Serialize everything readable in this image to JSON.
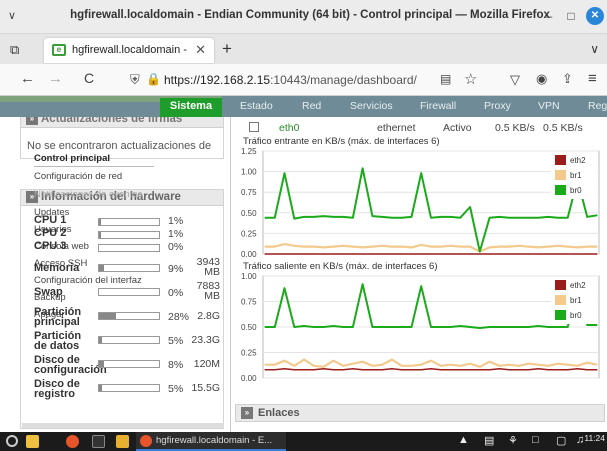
{
  "window": {
    "title": "hgfirewall.localdomain - Endian Community (64 bit) - Control principal — Mozilla Firefox",
    "menu_glyph": "∨",
    "min": "–",
    "max": "□",
    "close": "✕"
  },
  "tab": {
    "title": "hgfirewall.localdomain - Enc",
    "close": "✕",
    "new": "+",
    "list": "⧉",
    "dropdown": "∨"
  },
  "nav": {
    "back": "←",
    "forward": "→",
    "reload": "C",
    "url_host": "https://192.168.2.15",
    "url_path": ":10443/manage/dashboard/",
    "reader": "▤",
    "bookmark": "☆",
    "pocket": "▽",
    "account": "◉",
    "share": "⇪",
    "menu": "≡"
  },
  "appnav": {
    "active": "Sistema",
    "items": [
      "Estado",
      "Red",
      "Servicios",
      "Firewall",
      "Proxy",
      "VPN",
      "Regi"
    ]
  },
  "sidebar": {
    "updates_title": "Actualizaciones de firmas",
    "updates_text": "No se encontraron actualizaciones de",
    "hw_title": "Información del hardware",
    "menu": [
      "Control principal",
      "Configuración de red",
      "Notificaciones de eventos",
      "Updates",
      "Usuarios",
      "Consola web",
      "Acceso SSH",
      "Configuración del interfaz",
      "Backup",
      "Apagar"
    ],
    "hardware": [
      {
        "label": "CPU 1",
        "percent": "1%",
        "fill": 0.01,
        "size": ""
      },
      {
        "label": "CPU 2",
        "percent": "1%",
        "fill": 0.01,
        "size": ""
      },
      {
        "label": "CPU 3",
        "percent": "0%",
        "fill": 0.0,
        "size": ""
      },
      {
        "label": "Memoria",
        "percent": "9%",
        "fill": 0.09,
        "size": "3943 MB"
      },
      {
        "label": "Swap",
        "percent": "0%",
        "fill": 0.0,
        "size": "7883 MB"
      },
      {
        "label": "Partición principal",
        "percent": "28%",
        "fill": 0.28,
        "size": "2.8G"
      },
      {
        "label": "Partición de datos",
        "percent": "5%",
        "fill": 0.05,
        "size": "23.3G"
      },
      {
        "label": "Disco de configuración",
        "percent": "8%",
        "fill": 0.08,
        "size": "120M"
      },
      {
        "label": "Disco de registro",
        "percent": "5%",
        "fill": 0.05,
        "size": "15.5G"
      }
    ]
  },
  "interface_row": {
    "name": "eth0",
    "type": "ethernet",
    "state": "Activo",
    "in": "0.5 KB/s",
    "out": "0.5 KB/s"
  },
  "enlaces": "Enlaces",
  "taskbar": {
    "task_label": "hgfirewall.localdomain - E...",
    "clock": "11:24"
  },
  "chart_data": [
    {
      "type": "line",
      "title": "Tráfico entrante en KB/s (máx. de interfaces 6)",
      "ylim": [
        0,
        1.25
      ],
      "yticks": [
        "1.25",
        "1.00",
        "0.75",
        "0.50",
        "0.25",
        "0.00"
      ],
      "colors": {
        "eth2": "#9b1c1c",
        "br1": "#f4c98c",
        "br0": "#1aaa1a"
      },
      "series": [
        {
          "name": "eth2",
          "values": [
            0,
            0,
            0,
            0,
            0,
            0,
            0,
            0,
            0,
            0,
            0,
            0,
            0,
            0,
            0,
            0,
            0,
            0,
            0,
            0,
            0,
            0,
            0,
            0,
            0,
            0,
            0,
            0,
            0,
            0,
            0,
            0,
            0,
            0,
            0
          ]
        },
        {
          "name": "br1",
          "values": [
            0.09,
            0.09,
            0.12,
            0.1,
            0.09,
            0.09,
            0.08,
            0.09,
            0.1,
            0.09,
            0.08,
            0.09,
            0.1,
            0.09,
            0.09,
            0.08,
            0.11,
            0.09,
            0.09,
            0.1,
            0.09,
            0.09,
            0.03,
            0.08,
            0.09,
            0.09,
            0.1,
            0.09,
            0.08,
            0.09,
            0.1,
            0.09,
            0.08,
            0.09,
            0.09
          ]
        },
        {
          "name": "br0",
          "values": [
            0.44,
            0.44,
            0.98,
            0.43,
            0.45,
            0.45,
            0.46,
            0.45,
            0.45,
            0.44,
            1.04,
            0.46,
            0.45,
            0.44,
            0.44,
            0.45,
            0.98,
            0.44,
            0.45,
            0.45,
            0.44,
            0.57,
            0.03,
            0.44,
            0.45,
            0.44,
            0.44,
            0.44,
            0.44,
            0.45,
            0.44,
            0.44,
            0.9,
            0.45,
            0.47
          ]
        }
      ]
    },
    {
      "type": "line",
      "title": "Tráfico saliente en KB/s (máx. de interfaces 6)",
      "ylim": [
        0,
        1.0
      ],
      "yticks": [
        "1.00",
        "0.75",
        "0.50",
        "0.25",
        "0.00"
      ],
      "colors": {
        "eth2": "#9b1c1c",
        "br1": "#f4c98c",
        "br0": "#1aaa1a"
      },
      "series": [
        {
          "name": "eth2",
          "values": [
            0.08,
            0.08,
            0.09,
            0.08,
            0.08,
            0.08,
            0.09,
            0.08,
            0.08,
            0.09,
            0.08,
            0.08,
            0.08,
            0.09,
            0.08,
            0.08,
            0.08,
            0.09,
            0.08,
            0.08,
            0.08,
            0.08,
            0.08,
            0.08,
            0.09,
            0.08,
            0.08,
            0.08,
            0.09,
            0.08,
            0.08,
            0.08,
            0.09,
            0.08,
            0.08
          ]
        },
        {
          "name": "br1",
          "values": [
            0.13,
            0.13,
            0.17,
            0.12,
            0.18,
            0.12,
            0.11,
            0.17,
            0.12,
            0.14,
            0.16,
            0.12,
            0.13,
            0.18,
            0.12,
            0.12,
            0.13,
            0.17,
            0.12,
            0.13,
            0.12,
            0.14,
            0.11,
            0.16,
            0.12,
            0.13,
            0.12,
            0.14,
            0.13,
            0.12,
            0.14,
            0.13,
            0.12,
            0.15,
            0.13
          ]
        },
        {
          "name": "br0",
          "values": [
            0.5,
            0.5,
            0.88,
            0.5,
            0.51,
            0.5,
            0.5,
            0.51,
            0.5,
            0.5,
            0.92,
            0.5,
            0.5,
            0.5,
            0.5,
            0.5,
            0.9,
            0.5,
            0.5,
            0.5,
            0.51,
            0.5,
            0.49,
            0.5,
            0.5,
            0.5,
            0.5,
            0.5,
            0.51,
            0.5,
            0.5,
            0.5,
            0.88,
            0.52,
            0.52
          ]
        }
      ]
    }
  ]
}
